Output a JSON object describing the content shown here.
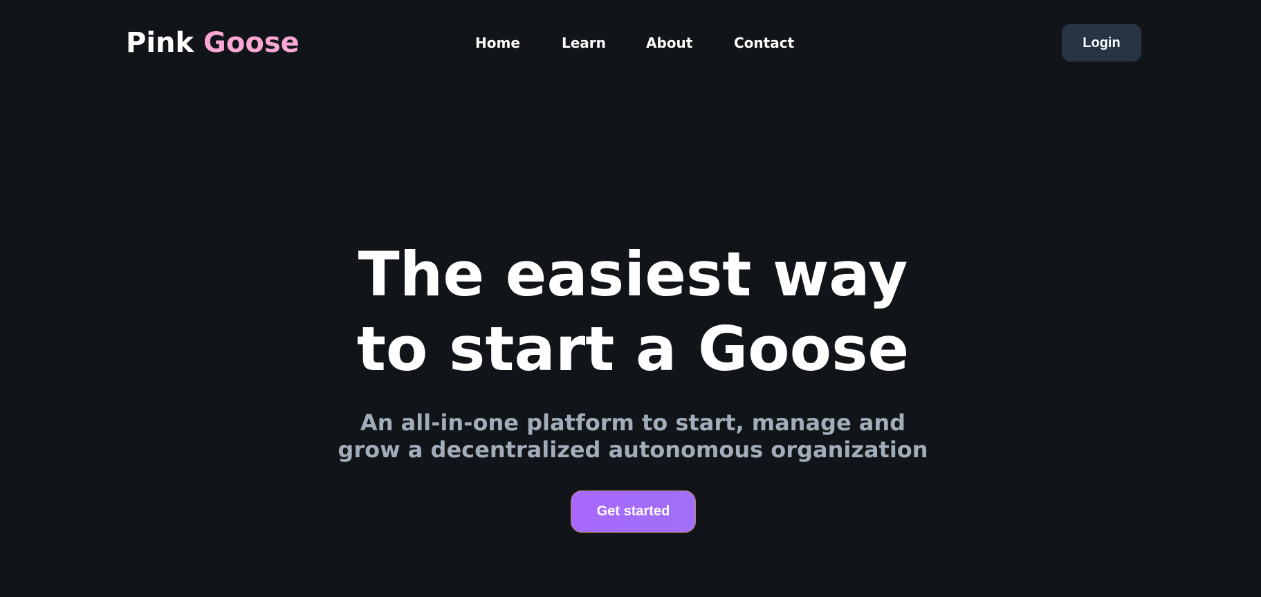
{
  "header": {
    "brand": {
      "first": "Pink",
      "second": "Goose"
    },
    "nav": [
      {
        "label": "Home"
      },
      {
        "label": "Learn"
      },
      {
        "label": "About"
      },
      {
        "label": "Contact"
      }
    ],
    "login_label": "Login"
  },
  "hero": {
    "title_line1": "The easiest way",
    "title_line2": "to start a Goose",
    "subtitle_line1": "An all-in-one platform to start, manage and",
    "subtitle_line2": "grow a decentralized autonomous organization",
    "cta_label": "Get started"
  },
  "colors": {
    "background": "#111418",
    "brand_accent": "#f9a8d4",
    "login_bg": "#283444",
    "subtitle": "#a2acba",
    "cta_bg": "#a868fb"
  }
}
